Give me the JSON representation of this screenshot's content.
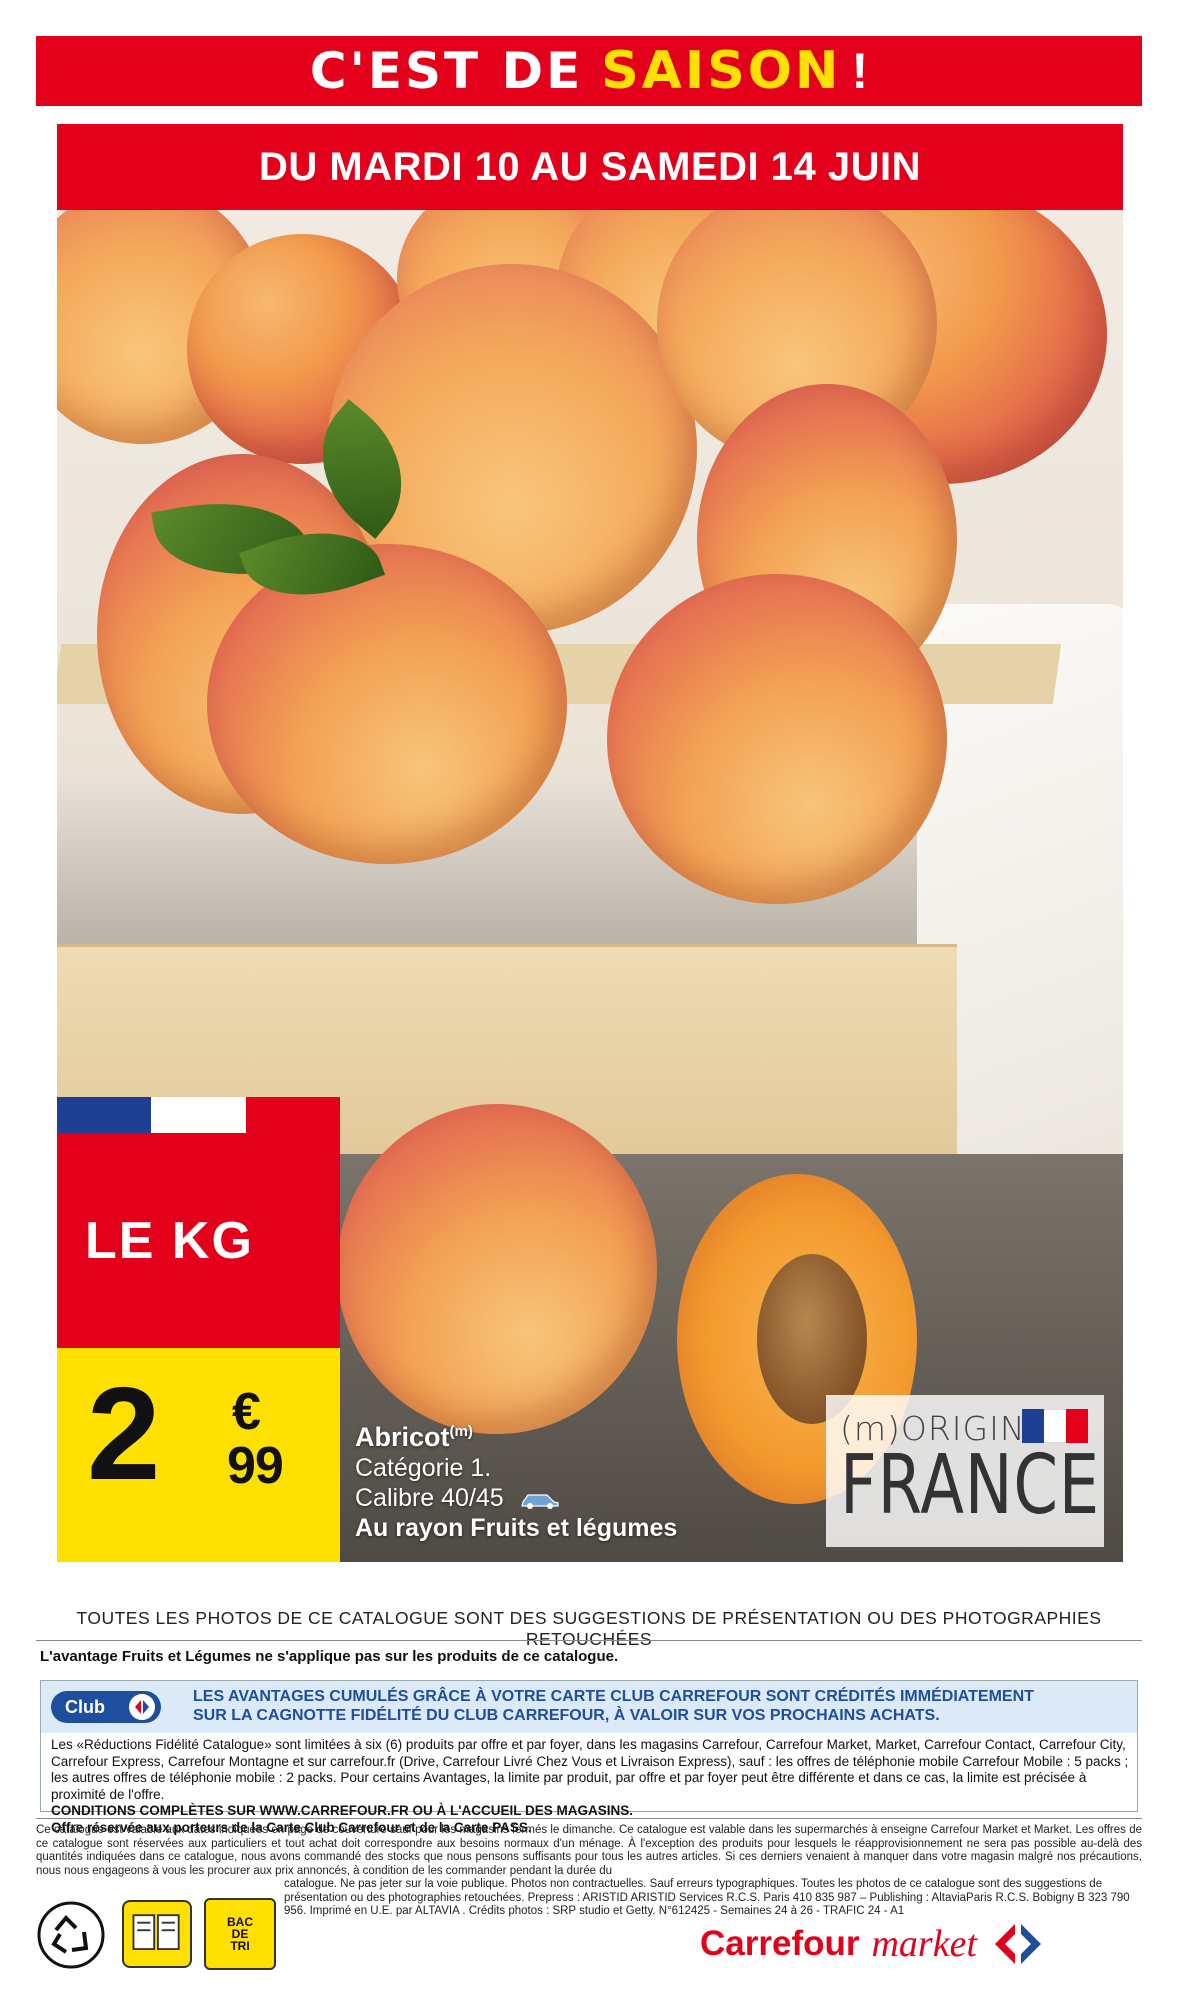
{
  "header": {
    "title_part1": "C'EST DE",
    "title_part2": "SAISON",
    "title_part3": "!",
    "dates": "DU MARDI 10 AU SAMEDI 14 JUIN"
  },
  "price": {
    "unit": "LE KG",
    "integer": "2",
    "currency": "€",
    "decimals": "99"
  },
  "product": {
    "name": "Abricot",
    "name_sup": "(m)",
    "category": "Catégorie 1.",
    "caliber": "Calibre 40/45",
    "aisle": "Au rayon Fruits et légumes"
  },
  "origin": {
    "prefix": "(m)ORIGINE",
    "country": "FRANCE"
  },
  "disclaimer": "TOUTES LES PHOTOS DE CE CATALOGUE SONT DES SUGGESTIONS DE PRÉSENTATION OU DES PHOTOGRAPHIES RETOUCHÉES",
  "fruit_note": "L'avantage Fruits et Légumes ne s'applique pas sur les produits de ce catalogue.",
  "club": {
    "badge": "Club",
    "headline_1": "LES AVANTAGES CUMULÉS GRÂCE À VOTRE CARTE CLUB CARREFOUR SONT CRÉDITÉS IMMÉDIATEMENT",
    "headline_2": "SUR LA CAGNOTTE FIDÉLITÉ DU CLUB CARREFOUR, À VALOIR SUR VOS PROCHAINS ACHATS.",
    "body_1": "Les «Réductions Fidélité Catalogue» sont limitées à six (6) produits par offre et par foyer, dans les magasins Carrefour, Carrefour Market, Market, Carrefour Contact, Carrefour City, Carrefour Express, Carrefour Montagne et sur carrefour.fr (Drive, Carrefour Livré Chez Vous et Livraison Express), sauf : les offres de téléphonie mobile Carrefour Mobile : 5 packs ; les autres offres de téléphonie mobile : 2 packs. Pour certains Avantages, la limite par produit, par offre et par foyer peut être différente et dans ce cas, la limite est précisée à proximité de l'offre.",
    "body_2": "CONDITIONS COMPLÈTES SUR WWW.CARREFOUR.FR OU À L'ACCUEIL DES MAGASINS.",
    "body_3": "Offre réservée aux porteurs de la Carte Club Carrefour et de la Carte PASS."
  },
  "legal": {
    "text_1": "Ce catalogue est valable aux dates indiquées en page de couverture sauf pour les magasins fermés le dimanche. Ce catalogue est valable dans les supermarchés à enseigne Carrefour Market et Market. Les offres de ce catalogue sont réservées aux particuliers et tout achat doit correspondre aux besoins normaux d'un ménage. À l'exception des produits pour lesquels le réapprovisionnement ne sera pas possible au-delà des quantités indiquées dans ce catalogue, nous avons commandé des stocks que nous pensons suffisants pour tous les autres articles. Si ces derniers venaient à manquer dans votre magasin malgré nos précautions, nous nous engageons à vous les procurer aux prix annoncés, à condition de les commander pendant la durée du",
    "text_2": "catalogue. Ne pas jeter sur la voie publique. Photos non contractuelles. Sauf erreurs typographiques. Toutes les photos de ce catalogue sont des suggestions de présentation ou des photographies retouchées. Prepress : ARISTID ARISTID Services R.C.S. Paris 410 835 987 – Publishing : AltaviaParis R.C.S. Bobigny B 323 790 956. Imprimé en U.E. par ALTAVIA . Crédits photos : SRP studio et Getty. N°612425 - Semaines 24 à 26 - TRAFIC 24 - A1"
  },
  "recycle": {
    "bin_label_1": "BAC",
    "bin_label_2": "DE",
    "bin_label_3": "TRI"
  },
  "brand": {
    "name": "Carrefour",
    "suffix": "market"
  },
  "colors": {
    "red": "#e3001b",
    "yellow": "#ffe000",
    "club_blue": "#1e4e9c",
    "flag_blue": "#1f3f95"
  },
  "icons": [
    "car-icon",
    "carrefour-logo-icon",
    "triman-icon",
    "book-icon",
    "recycling-bin-icon",
    "france-flag-icon"
  ]
}
